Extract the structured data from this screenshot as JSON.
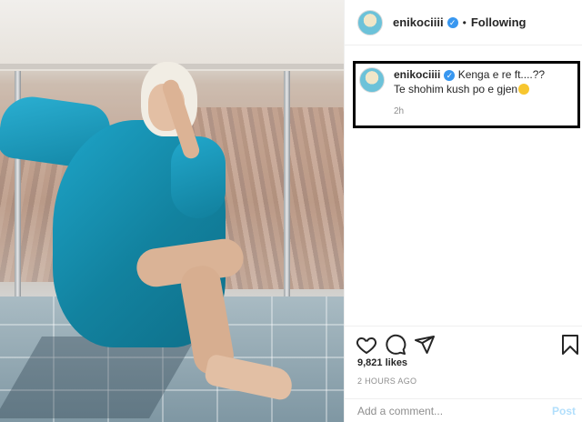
{
  "post": {
    "username": "enikociiii",
    "follow_status": "Following",
    "verified_icon": "verified-badge-icon",
    "caption_text": "Kenga e re ft....?? Te shohim kush po e gjen",
    "caption_emoji": "winking-face-with-tongue-emoji",
    "caption_time": "2h",
    "likes": "9,821 likes",
    "posted_ago": "2 HOURS AGO"
  },
  "actions": {
    "icons": [
      "heart-icon",
      "comment-icon",
      "share-icon",
      "bookmark-icon"
    ]
  },
  "comment_box": {
    "placeholder": "Add a comment...",
    "post_label": "Post"
  },
  "colors": {
    "verified_blue": "#3897f0",
    "post_disabled": "#b2dffc"
  }
}
